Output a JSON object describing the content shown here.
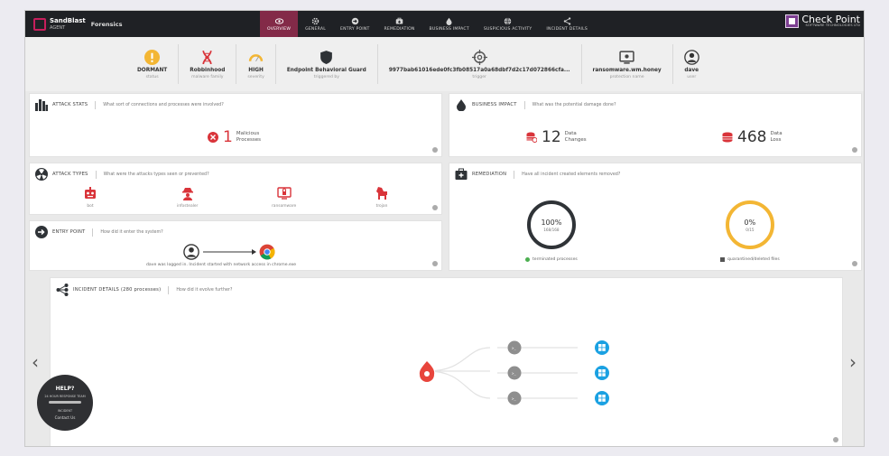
{
  "app": {
    "brand_name": "SandBlast",
    "brand_sub": "AGENT",
    "product": "Forensics",
    "vendor": "Check Point",
    "vendor_sub": "SOFTWARE TECHNOLOGIES LTD"
  },
  "tabs": [
    {
      "label": "OVERVIEW",
      "icon": "eye-icon",
      "active": true
    },
    {
      "label": "GENERAL",
      "icon": "gear-icon",
      "active": false
    },
    {
      "label": "ENTRY POINT",
      "icon": "entry-icon",
      "active": false
    },
    {
      "label": "REMEDIATION",
      "icon": "remediation-icon",
      "active": false
    },
    {
      "label": "BUSINESS IMPACT",
      "icon": "drop-icon",
      "active": false
    },
    {
      "label": "SUSPICIOUS ACTIVITY",
      "icon": "globe-icon",
      "active": false
    },
    {
      "label": "INCIDENT DETAILS",
      "icon": "tree-icon",
      "active": false
    }
  ],
  "summary": [
    {
      "value": "DORMANT",
      "label": "status",
      "icon": "warning-icon"
    },
    {
      "value": "Robbinhood",
      "label": "malware family",
      "icon": "dna-icon"
    },
    {
      "value": "HIGH",
      "label": "severity",
      "icon": "gauge-icon"
    },
    {
      "value": "Endpoint Behavioral Guard",
      "label": "triggered by",
      "icon": "shield-icon"
    },
    {
      "value": "9977bab61016ede0fc3fb08517a0a68dbf7d2c17d072866cfa...",
      "label": "trigger",
      "icon": "crosshair-icon"
    },
    {
      "value": "ransomware.wm.honey",
      "label": "protection name",
      "icon": "monitor-icon"
    },
    {
      "value": "dave",
      "label": "user",
      "icon": "user-icon"
    }
  ],
  "attack_stats": {
    "title": "ATTACK STATS",
    "question": "What sort of connections and processes were involved?",
    "count": "1",
    "desc_1": "Malicious",
    "desc_2": "Processes"
  },
  "business_impact": {
    "title": "BUSINESS IMPACT",
    "question": "What was the potential damage done?",
    "changes_count": "12",
    "changes_1": "Data",
    "changes_2": "Changes",
    "loss_count": "468",
    "loss_1": "Data",
    "loss_2": "Loss"
  },
  "attack_types": {
    "title": "ATTACK TYPES",
    "question": "What were the attacks types seen or prevented?",
    "items": [
      {
        "label": "bot",
        "icon": "robot-icon"
      },
      {
        "label": "infostealer",
        "icon": "spy-icon"
      },
      {
        "label": "ransomware",
        "icon": "ransomware-icon"
      },
      {
        "label": "trojan",
        "icon": "trojan-horse-icon"
      }
    ]
  },
  "remediation": {
    "title": "REMEDIATION",
    "question": "Have all incident created elements removed?",
    "terminated_pct": "100%",
    "terminated_frac": "168/168",
    "terminated_label": "terminated processes",
    "quarantined_pct": "0%",
    "quarantined_frac": "0/15",
    "quarantined_label": "quarantined/deleted files",
    "colors": {
      "terminated": "#2f3337",
      "quarantined": "#f3b634"
    }
  },
  "entry_point": {
    "title": "ENTRY POINT",
    "question": "How did it enter the system?",
    "caption": "dave was logged in. Incident started with network access in chrome.exe"
  },
  "incident_details": {
    "title": "INCIDENT DETAILS (280 processes)",
    "question": "How did it evolve further?"
  },
  "help": {
    "title": "HELP?",
    "line": "24 HOUR RESPONSE TEAM",
    "badge": "INCIDENT",
    "contact": "Contact Us"
  }
}
